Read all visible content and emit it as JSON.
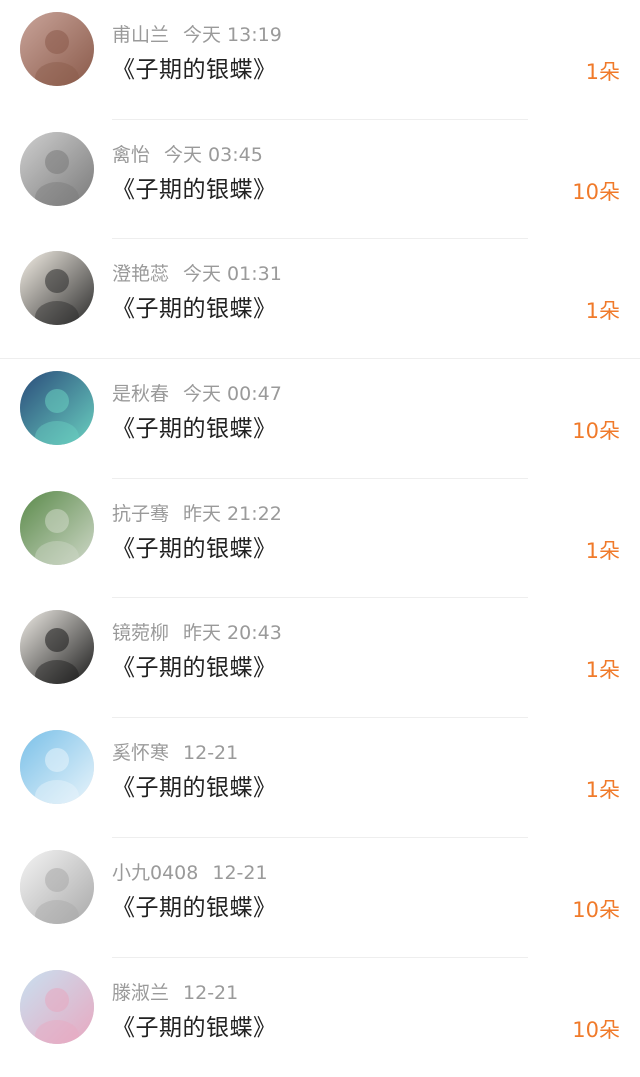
{
  "gifts": [
    {
      "name": "甫山兰",
      "time": "今天 13:19",
      "title": "《子期的银蝶》",
      "count": "1朵",
      "avatar": "avatar-person-brick-wall-icon",
      "colors": [
        "#c9a49a",
        "#8a5a4a"
      ]
    },
    {
      "name": "禽怡",
      "time": "今天 03:45",
      "title": "《子期的银蝶》",
      "count": "10朵",
      "avatar": "avatar-anime-grey-boy-icon",
      "colors": [
        "#cfcfcf",
        "#7a7a7a"
      ]
    },
    {
      "name": "澄艳蕊",
      "time": "今天 01:31",
      "title": "《子期的银蝶》",
      "count": "1朵",
      "avatar": "avatar-anime-bunny-girl-icon",
      "colors": [
        "#f4efe6",
        "#2b2b2b"
      ]
    },
    {
      "name": "是秋春",
      "time": "今天 00:47",
      "title": "《子期的银蝶》",
      "count": "10朵",
      "avatar": "avatar-anime-night-icon",
      "colors": [
        "#2a4b7a",
        "#6ad0c0"
      ]
    },
    {
      "name": "抗子骞",
      "time": "昨天 21:22",
      "title": "《子期的银蝶》",
      "count": "1朵",
      "avatar": "avatar-path-landscape-icon",
      "colors": [
        "#5a8a4a",
        "#cfd8c8"
      ]
    },
    {
      "name": "镜菀柳",
      "time": "昨天 20:43",
      "title": "《子期的银蝶》",
      "count": "1朵",
      "avatar": "avatar-ink-girl-icon",
      "colors": [
        "#efece6",
        "#1a1a1a"
      ]
    },
    {
      "name": "奚怀寒",
      "time": "12-21",
      "title": "《子期的银蝶》",
      "count": "1朵",
      "avatar": "avatar-sky-clouds-icon",
      "colors": [
        "#7ac0e8",
        "#e8f4fb"
      ]
    },
    {
      "name": "小九0408",
      "time": "12-21",
      "title": "《子期的银蝶》",
      "count": "10朵",
      "avatar": "avatar-sketch-girl-icon",
      "colors": [
        "#f4f4f4",
        "#a9a9a9"
      ]
    },
    {
      "name": "滕淑兰",
      "time": "12-21",
      "title": "《子期的银蝶》",
      "count": "10朵",
      "avatar": "avatar-peach-blossom-icon",
      "colors": [
        "#c8e0f0",
        "#e8a8c0"
      ]
    }
  ]
}
